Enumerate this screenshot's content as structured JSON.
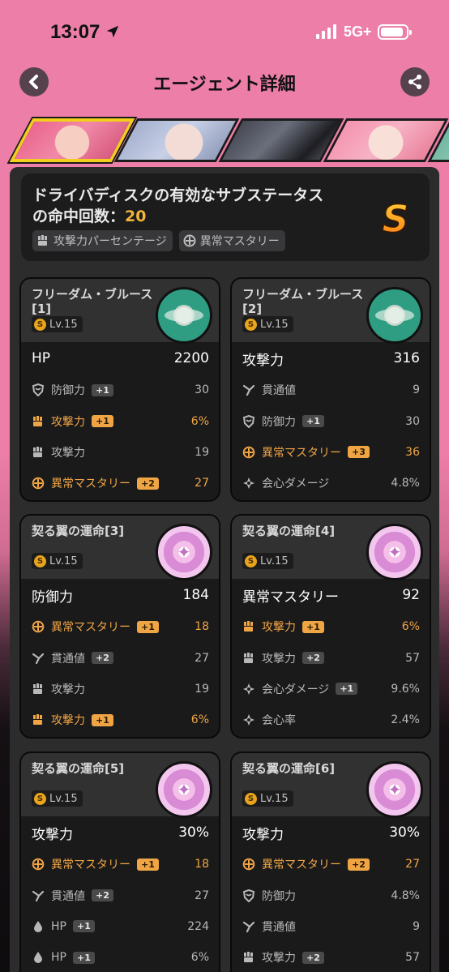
{
  "status_bar": {
    "time": "13:07",
    "network": "5G+"
  },
  "header": {
    "title": "エージェント詳細"
  },
  "summary": {
    "line": "ドライバディスクの有効なサブステータスの命中回数：",
    "count": "20",
    "tags": [
      "攻撃力パーセンテージ",
      "異常マスタリー"
    ],
    "rank": "S"
  },
  "cards": [
    {
      "name": "フリーダム・ブルース[1]",
      "level": "Lv.15",
      "disc": "green",
      "main": {
        "label": "HP",
        "value": "2200"
      },
      "subs": [
        {
          "icon": "shield-icon",
          "label": "防御力",
          "badge": "+1",
          "value": "30",
          "hl": false
        },
        {
          "icon": "fist-icon",
          "label": "攻撃力",
          "badge": "+1",
          "value": "6%",
          "hl": true
        },
        {
          "icon": "fist-icon",
          "label": "攻撃力",
          "badge": "",
          "value": "19",
          "hl": false
        },
        {
          "icon": "mastery-icon",
          "label": "異常マスタリー",
          "badge": "+2",
          "value": "27",
          "hl": true
        }
      ]
    },
    {
      "name": "フリーダム・ブルース[2]",
      "level": "Lv.15",
      "disc": "green",
      "main": {
        "label": "攻撃力",
        "value": "316"
      },
      "subs": [
        {
          "icon": "pierce-icon",
          "label": "貫通値",
          "badge": "",
          "value": "9",
          "hl": false
        },
        {
          "icon": "shield-icon",
          "label": "防御力",
          "badge": "+1",
          "value": "30",
          "hl": false
        },
        {
          "icon": "mastery-icon",
          "label": "異常マスタリー",
          "badge": "+3",
          "value": "36",
          "hl": true
        },
        {
          "icon": "crit-icon",
          "label": "会心ダメージ",
          "badge": "",
          "value": "4.8%",
          "hl": false
        }
      ]
    },
    {
      "name": "契る翼の運命[3]",
      "level": "Lv.15",
      "disc": "pink",
      "main": {
        "label": "防御力",
        "value": "184"
      },
      "subs": [
        {
          "icon": "mastery-icon",
          "label": "異常マスタリー",
          "badge": "+1",
          "value": "18",
          "hl": true
        },
        {
          "icon": "pierce-icon",
          "label": "貫通値",
          "badge": "+2",
          "value": "27",
          "hl": false
        },
        {
          "icon": "fist-icon",
          "label": "攻撃力",
          "badge": "",
          "value": "19",
          "hl": false
        },
        {
          "icon": "fist-icon",
          "label": "攻撃力",
          "badge": "+1",
          "value": "6%",
          "hl": true
        }
      ]
    },
    {
      "name": "契る翼の運命[4]",
      "level": "Lv.15",
      "disc": "pink",
      "main": {
        "label": "異常マスタリー",
        "value": "92"
      },
      "subs": [
        {
          "icon": "fist-icon",
          "label": "攻撃力",
          "badge": "+1",
          "value": "6%",
          "hl": true
        },
        {
          "icon": "fist-icon",
          "label": "攻撃力",
          "badge": "+2",
          "value": "57",
          "hl": false
        },
        {
          "icon": "crit-icon",
          "label": "会心ダメージ",
          "badge": "+1",
          "value": "9.6%",
          "hl": false
        },
        {
          "icon": "crit-icon",
          "label": "会心率",
          "badge": "",
          "value": "2.4%",
          "hl": false
        }
      ]
    },
    {
      "name": "契る翼の運命[5]",
      "level": "Lv.15",
      "disc": "pink",
      "main": {
        "label": "攻撃力",
        "value": "30%"
      },
      "subs": [
        {
          "icon": "mastery-icon",
          "label": "異常マスタリー",
          "badge": "+1",
          "value": "18",
          "hl": true
        },
        {
          "icon": "pierce-icon",
          "label": "貫通値",
          "badge": "+2",
          "value": "27",
          "hl": false
        },
        {
          "icon": "drop-icon",
          "label": "HP",
          "badge": "+1",
          "value": "224",
          "hl": false
        },
        {
          "icon": "drop-icon",
          "label": "HP",
          "badge": "+1",
          "value": "6%",
          "hl": false
        }
      ]
    },
    {
      "name": "契る翼の運命[6]",
      "level": "Lv.15",
      "disc": "pink",
      "main": {
        "label": "攻撃力",
        "value": "30%"
      },
      "subs": [
        {
          "icon": "mastery-icon",
          "label": "異常マスタリー",
          "badge": "+2",
          "value": "27",
          "hl": true
        },
        {
          "icon": "shield-icon",
          "label": "防御力",
          "badge": "",
          "value": "4.8%",
          "hl": false
        },
        {
          "icon": "pierce-icon",
          "label": "貫通値",
          "badge": "",
          "value": "9",
          "hl": false
        },
        {
          "icon": "fist-icon",
          "label": "攻撃力",
          "badge": "+2",
          "value": "57",
          "hl": false
        }
      ]
    }
  ],
  "colors": {
    "accent": "#f0a545",
    "header_bg": "#ec7ea8",
    "selected_frame": "#f2cf1e"
  }
}
